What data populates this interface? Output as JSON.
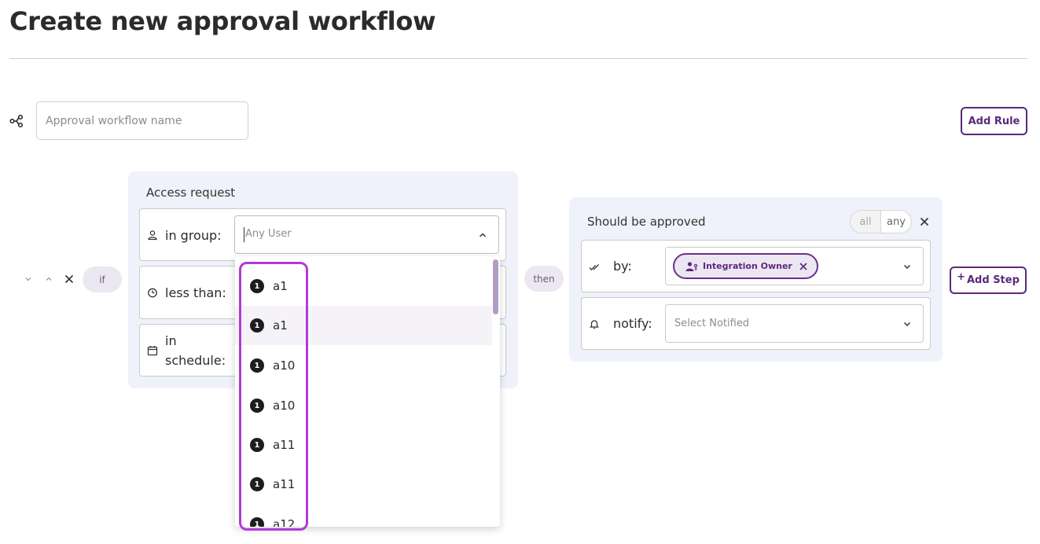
{
  "page": {
    "title": "Create new approval workflow"
  },
  "workflow": {
    "name_placeholder": "Approval workflow name",
    "add_rule_label": "Add Rule"
  },
  "rule": {
    "if_label": "if",
    "then_label": "then",
    "access": {
      "title": "Access request",
      "group_label": "in group:",
      "group_placeholder": "Any User",
      "less_than_label": "less than:",
      "schedule_label_line1": "in",
      "schedule_label_line2": "schedule:"
    },
    "group_options": [
      {
        "badge": "1",
        "label": "a1"
      },
      {
        "badge": "1",
        "label": "a1"
      },
      {
        "badge": "1",
        "label": "a10"
      },
      {
        "badge": "1",
        "label": "a10"
      },
      {
        "badge": "1",
        "label": "a11"
      },
      {
        "badge": "1",
        "label": "a11"
      },
      {
        "badge": "1",
        "label": "a12"
      }
    ],
    "approval": {
      "title": "Should be approved",
      "mode_all": "all",
      "mode_any": "any",
      "by_label": "by:",
      "approver_chip": "Integration Owner",
      "notify_label": "notify:",
      "notify_placeholder": "Select Notified"
    },
    "add_step_plus": "+",
    "add_step_label": "Add Step"
  },
  "colors": {
    "accent": "#5b2a7a",
    "focus_outline": "#b23ad6",
    "card_background": "#f0f2fb",
    "pill_background": "#ece8f1"
  },
  "icons": {
    "workflow": "workflow-icon",
    "user": "user-icon",
    "timer": "timer-icon",
    "calendar": "calendar-icon",
    "double_check": "double-check-icon",
    "bell": "bell-icon",
    "user_key": "user-key-icon"
  }
}
